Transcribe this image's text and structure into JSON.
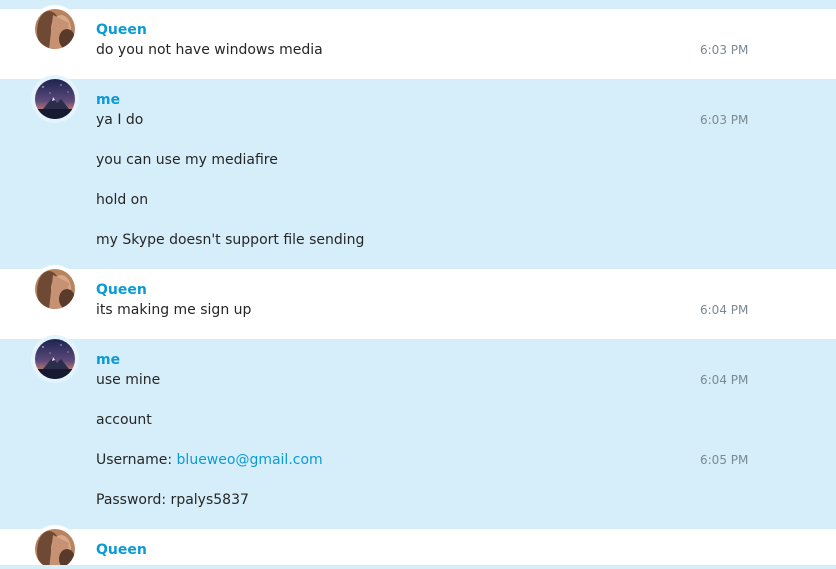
{
  "messages": [
    {
      "sender": "Queen",
      "lines": [
        {
          "text": "do you not have windows media",
          "time": "6:03 PM"
        }
      ]
    },
    {
      "sender": "me",
      "lines": [
        {
          "text": "ya I do",
          "time": "6:03 PM"
        },
        {
          "text": "you can use my mediafire"
        },
        {
          "text": "hold on"
        },
        {
          "text": "my Skype doesn't support file sending"
        }
      ]
    },
    {
      "sender": "Queen",
      "lines": [
        {
          "text": "its making me sign up",
          "time": "6:04 PM"
        }
      ]
    },
    {
      "sender": "me",
      "lines": [
        {
          "text": "use mine",
          "time": "6:04 PM"
        },
        {
          "text": "account"
        },
        {
          "prefix": "Username: ",
          "link": "blueweo@gmail.com",
          "time": "6:05 PM"
        },
        {
          "text": "Password: rpalys5837"
        }
      ]
    },
    {
      "sender": "Queen",
      "lines": []
    }
  ]
}
